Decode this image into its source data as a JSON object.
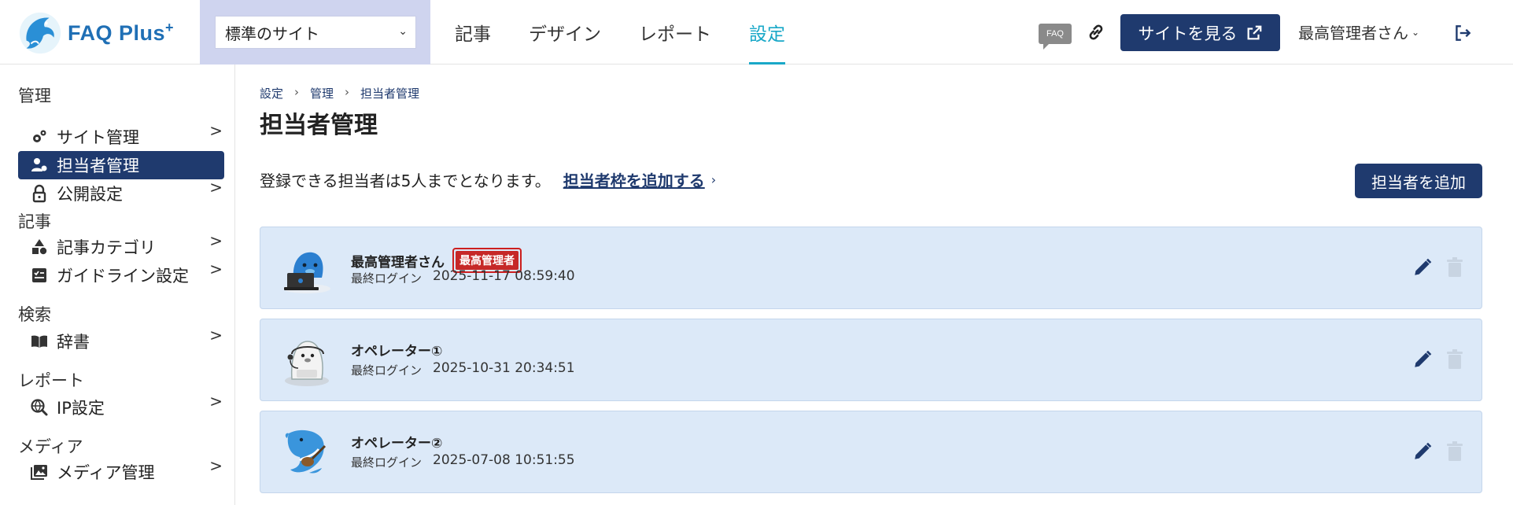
{
  "header": {
    "logo_text": "FAQ Plus",
    "logo_plus": "+",
    "site_select": {
      "value": "標準のサイト"
    },
    "nav": [
      {
        "label": "記事",
        "active": false
      },
      {
        "label": "デザイン",
        "active": false
      },
      {
        "label": "レポート",
        "active": false
      },
      {
        "label": "設定",
        "active": true
      }
    ],
    "faq_badge": "FAQ",
    "view_site_label": "サイトを見る",
    "user_name": "最高管理者さん"
  },
  "sidebar": {
    "sections": [
      {
        "title": "管理",
        "items": [
          {
            "label": "サイト管理",
            "icon": "gears-icon",
            "active": false
          },
          {
            "label": "担当者管理",
            "icon": "user-gear-icon",
            "active": true
          },
          {
            "label": "公開設定",
            "icon": "lock-icon",
            "active": false
          }
        ]
      },
      {
        "title": "記事",
        "items": [
          {
            "label": "記事カテゴリ",
            "icon": "shapes-icon",
            "active": false
          },
          {
            "label": "ガイドライン設定",
            "icon": "checklist-icon",
            "active": false
          }
        ]
      },
      {
        "title": "検索",
        "items": [
          {
            "label": "辞書",
            "icon": "book-icon",
            "active": false
          }
        ]
      },
      {
        "title": "レポート",
        "items": [
          {
            "label": "IP設定",
            "icon": "ip-search-icon",
            "active": false
          }
        ]
      },
      {
        "title": "メディア",
        "items": [
          {
            "label": "メディア管理",
            "icon": "images-icon",
            "active": false
          }
        ]
      }
    ],
    "arrow": ">"
  },
  "main": {
    "breadcrumb": [
      "設定",
      "管理",
      "担当者管理"
    ],
    "breadcrumb_sep": "›",
    "title": "担当者管理",
    "limit_text": "登録できる担当者は5人までとなります。",
    "limit_link": "担当者枠を追加する",
    "limit_link_arrow": "›",
    "add_button": "担当者を追加",
    "login_label": "最終ログイン",
    "users": [
      {
        "name": "最高管理者さん",
        "badge": "最高管理者",
        "last_login": "2025-11-17 08:59:40",
        "avatar": "dolphin-laptop-avatar"
      },
      {
        "name": "オペレーター①",
        "badge": "",
        "last_login": "2025-10-31 20:34:51",
        "avatar": "seal-headset-avatar"
      },
      {
        "name": "オペレーター②",
        "badge": "",
        "last_login": "2025-07-08 10:51:55",
        "avatar": "dolphin-guitar-avatar"
      }
    ]
  },
  "colors": {
    "navy": "#1f3a6e",
    "accent": "#19a8c8",
    "card_bg": "#dce9f8",
    "badge_red": "#c62828",
    "select_bg": "#cfd4ef"
  }
}
